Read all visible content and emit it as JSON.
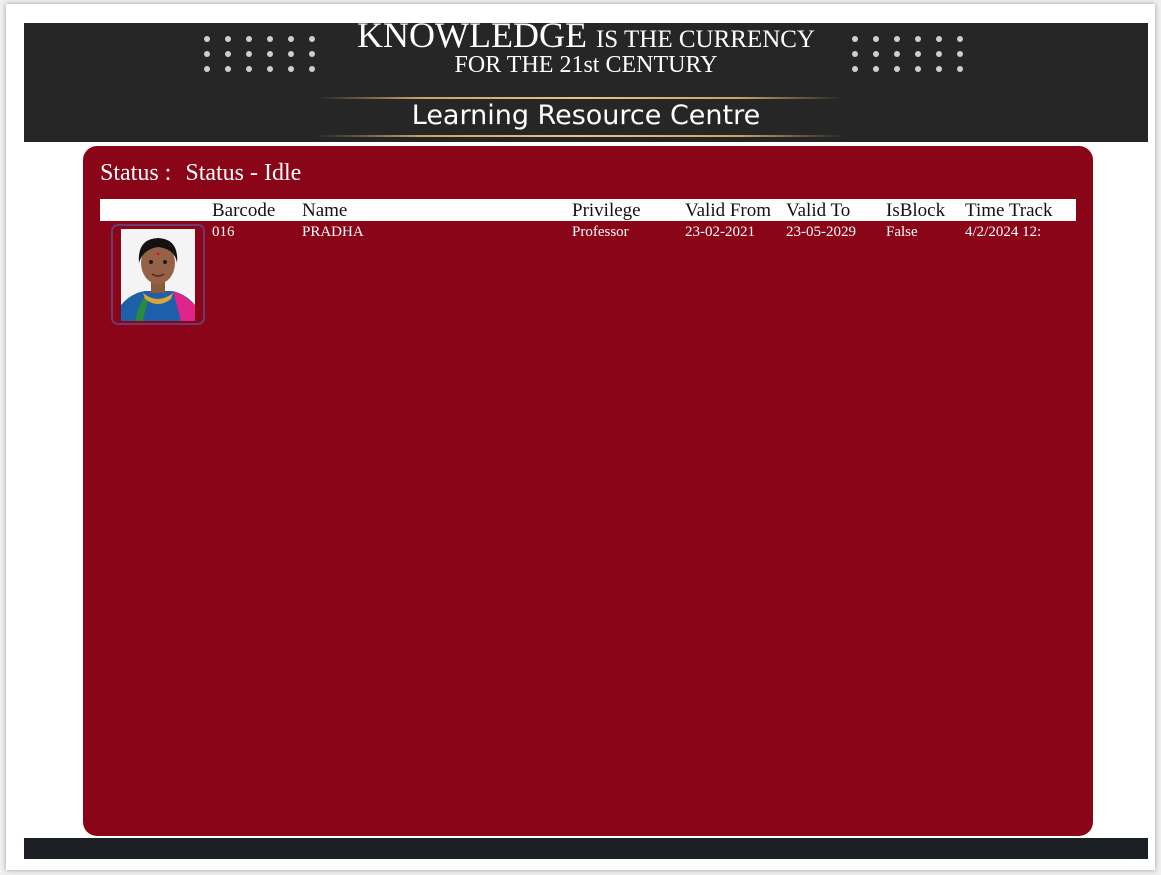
{
  "banner": {
    "tagline_big": "KNOWLEDGE",
    "tagline_rest": "IS THE CURRENCY",
    "tagline_line2": "FOR THE 21st CENTURY",
    "centre_title": "Learning Resource Centre"
  },
  "status": {
    "label": "Status :",
    "value": "Status - Idle"
  },
  "table": {
    "headers": {
      "barcode": "Barcode",
      "name": "Name",
      "privilege": "Privilege",
      "valid_from": "Valid From",
      "valid_to": "Valid To",
      "is_block": "IsBlock",
      "time_track": "Time Track"
    },
    "rows": [
      {
        "barcode": "016",
        "name": "PRADHA",
        "privilege": "Professor",
        "valid_from": "23-02-2021",
        "valid_to": "23-05-2029",
        "is_block": "False",
        "time_track": "4/2/2024 12:"
      }
    ]
  },
  "colors": {
    "panel": "#8b0519",
    "banner": "#262626",
    "accent_gold": "#c9a46a",
    "footer": "#1c1f24"
  },
  "icons": {
    "photo": "member-photo"
  }
}
